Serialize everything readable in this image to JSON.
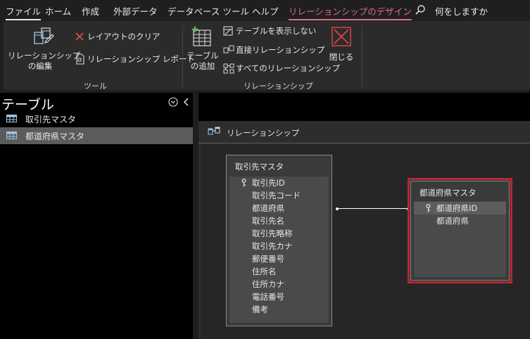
{
  "menu": {
    "tabs": [
      "ファイル",
      "ホーム",
      "作成",
      "外部データ",
      "データベース ツール",
      "ヘルプ",
      "リレーションシップのデザイン"
    ],
    "search_text": "何をしますか"
  },
  "ribbon": {
    "tools_group": {
      "edit_relationships_line1": "リレーションシップ",
      "edit_relationships_line2": "の編集",
      "clear_layout": "レイアウトのクリア",
      "relationship_report": "リレーションシップ レポート",
      "label": "ツール"
    },
    "relationships_group": {
      "add_tables_line1": "テーブル",
      "add_tables_line2": "の追加",
      "hide_table": "テーブルを表示しない",
      "direct_relationships": "直接リレーションシップ",
      "all_relationships": "すべてのリレーションシップ",
      "close": "閉じる",
      "label": "リレーションシップ"
    }
  },
  "nav": {
    "title": "テーブル",
    "items": [
      {
        "label": "取引先マスタ",
        "selected": false
      },
      {
        "label": "都道府県マスタ",
        "selected": true
      }
    ]
  },
  "document": {
    "tab_label": "リレーションシップ",
    "tables": [
      {
        "title": "取引先マスタ",
        "fields": [
          "取引先ID",
          "取引先コード",
          "都道府県",
          "取引先名",
          "取引先略称",
          "取引先カナ",
          "郵便番号",
          "住所名",
          "住所カナ",
          "電話番号",
          "備考"
        ],
        "key_field": 0
      },
      {
        "title": "都道府県マスタ",
        "fields": [
          "都道府県ID",
          "都道府県"
        ],
        "key_field": 0
      }
    ]
  },
  "colors": {
    "accent_tab": "#e06d8a",
    "selection_border": "#b42a34",
    "close_icon": "#e04848"
  }
}
